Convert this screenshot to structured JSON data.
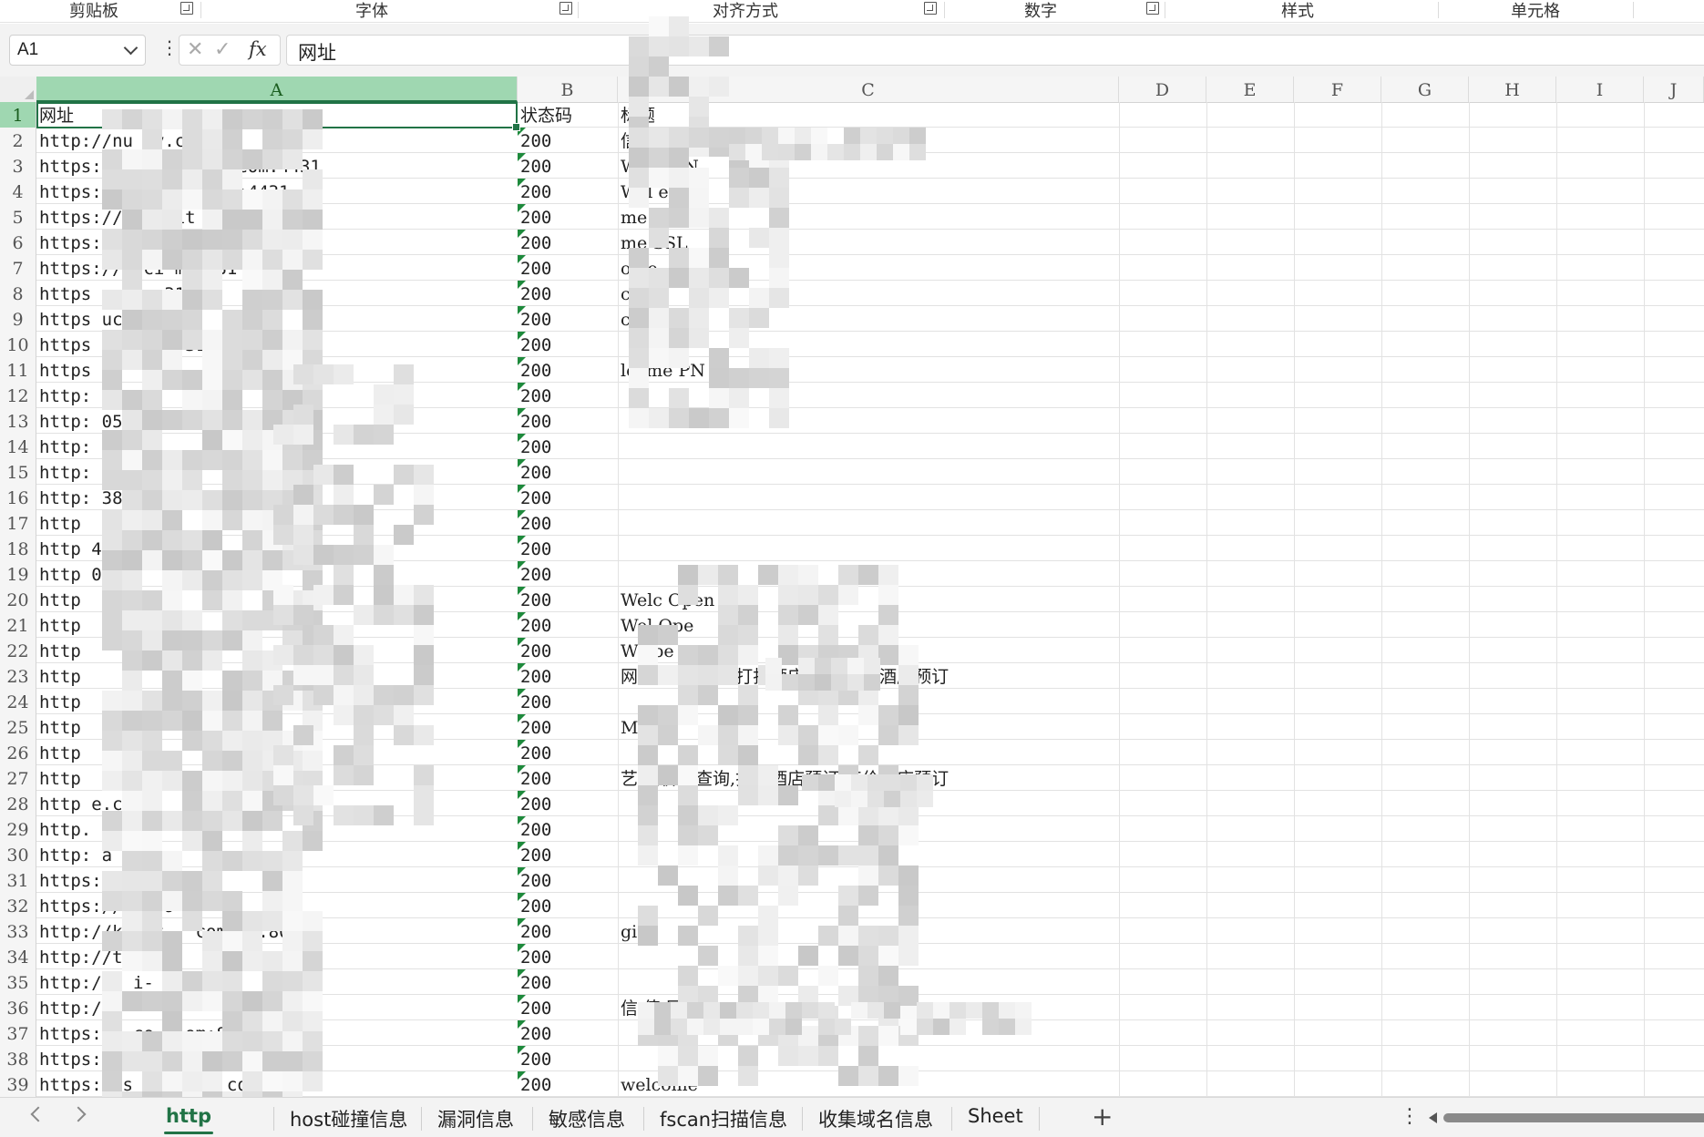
{
  "ribbon": {
    "groups": [
      "剪贴板",
      "字体",
      "对齐方式",
      "数字",
      "样式",
      "单元格"
    ]
  },
  "formula_bar": {
    "name_box": "A1",
    "fx_label": "fx",
    "content": "网址"
  },
  "columns": [
    "A",
    "B",
    "C",
    "D",
    "E",
    "F",
    "G",
    "H",
    "I",
    "J"
  ],
  "rows": [
    {
      "n": "1",
      "a": "网址",
      "b": "状态码",
      "c": "标题"
    },
    {
      "n": "2",
      "a": "http://nu    ty.com",
      "b": "200",
      "c": "信                               服务信息平台"
    },
    {
      "n": "3",
      "a": "https://c    f   uocity.com:4431",
      "b": "200",
      "c": "Welc  e       N"
    },
    {
      "n": "4",
      "a": "https://     b    oci   .com:4431",
      "b": "200",
      "c": "Wel   e        PN"
    },
    {
      "n": "5",
      "a": "https://y     r   cit    om:4431",
      "b": "200",
      "c": "    me SSL VP"
    },
    {
      "n": "6",
      "a": "https://c    c  nuc    .com:4431",
      "b": "200",
      "c": "    me SSL"
    },
    {
      "n": "7",
      "a": "https://c       ci     m:4431",
      "b": "200",
      "c": "    ome"
    },
    {
      "n": "8",
      "a": "https          no      om    31",
      "b": "200",
      "c": "    come"
    },
    {
      "n": "9",
      "a": "https          uc       or    31",
      "b": "200",
      "c": "    come"
    },
    {
      "n": "10",
      "a": "https   a       u     t    o     31",
      "b": "200",
      "c": ""
    },
    {
      "n": "11",
      "a": "https",
      "b": "200",
      "c": "   lcome          PN"
    },
    {
      "n": "12",
      "a": "http:                    05",
      "b": "200",
      "c": ""
    },
    {
      "n": "13",
      "a": "http:                    05",
      "b": "200",
      "c": ""
    },
    {
      "n": "14",
      "a": "http:                    05",
      "b": "200",
      "c": ""
    },
    {
      "n": "15",
      "a": "http:                    38",
      "b": "200",
      "c": ""
    },
    {
      "n": "16",
      "a": "http:                    38",
      "b": "200",
      "c": ""
    },
    {
      "n": "17",
      "a": "http",
      "b": "200",
      "c": ""
    },
    {
      "n": "18",
      "a": "http                       445",
      "b": "200",
      "c": ""
    },
    {
      "n": "19",
      "a": "http                       043",
      "b": "200",
      "c": ""
    },
    {
      "n": "20",
      "a": "http",
      "b": "200",
      "c": "Welc      Open"
    },
    {
      "n": "21",
      "a": "http",
      "b": "200",
      "c": "Wel       Ope"
    },
    {
      "n": "22",
      "a": "http",
      "b": "200",
      "c": "We         pe"
    },
    {
      "n": "23",
      "a": "http",
      "b": "200",
      "c": "                            网    店价格查询,打折酒店预订,特价酒店预订"
    },
    {
      "n": "24",
      "a": "http",
      "b": "200",
      "c": ""
    },
    {
      "n": "25",
      "a": "http",
      "b": "200",
      "c": "   M"
    },
    {
      "n": "26",
      "a": "http",
      "b": "200",
      "c": ""
    },
    {
      "n": "27",
      "a": "http",
      "b": "200",
      "c": "  艺                              店价格查询,打折酒店预订,特价酒店预订"
    },
    {
      "n": "28",
      "a": "http                      e.c",
      "b": "200",
      "c": ""
    },
    {
      "n": "29",
      "a": "http.                     e.",
      "b": "200",
      "c": ""
    },
    {
      "n": "30",
      "a": "http:            a        e.",
      "b": "200",
      "c": ""
    },
    {
      "n": "31",
      "a": "https://          -a          e",
      "b": "200",
      "c": ""
    },
    {
      "n": "32",
      "a": "https://          au               9",
      "b": "200",
      "c": ""
    },
    {
      "n": "33",
      "a": "http://k       -at        .         com.cn:8080",
      "b": "200",
      "c": "                gin"
    },
    {
      "n": "34",
      "a": "http://t        h          cn",
      "b": "200",
      "c": ""
    },
    {
      "n": "35",
      "a": "http://v       i-              n:8088",
      "b": "200",
      "c": ""
    },
    {
      "n": "36",
      "a": "http://a",
      "b": "200",
      "c": "信                          值                网"
    },
    {
      "n": "37",
      "a": "https://   ce-i            om:8043",
      "b": "200",
      "c": ""
    },
    {
      "n": "38",
      "a": "https://p   -ap            011",
      "b": "200",
      "c": ""
    },
    {
      "n": "39",
      "a": "https://s   nce-       sm     com:7011",
      "b": "200",
      "c": "welcome"
    }
  ],
  "sheet_tabs": [
    "http",
    "host碰撞信息",
    "漏洞信息",
    "敏感信息",
    "fscan扫描信息",
    "收集域名信息",
    "Sheet"
  ],
  "add_sheet_label": "+",
  "colors": {
    "accent": "#217346",
    "selected_header": "#9fd7b1",
    "gridline": "#e2e2e2"
  }
}
